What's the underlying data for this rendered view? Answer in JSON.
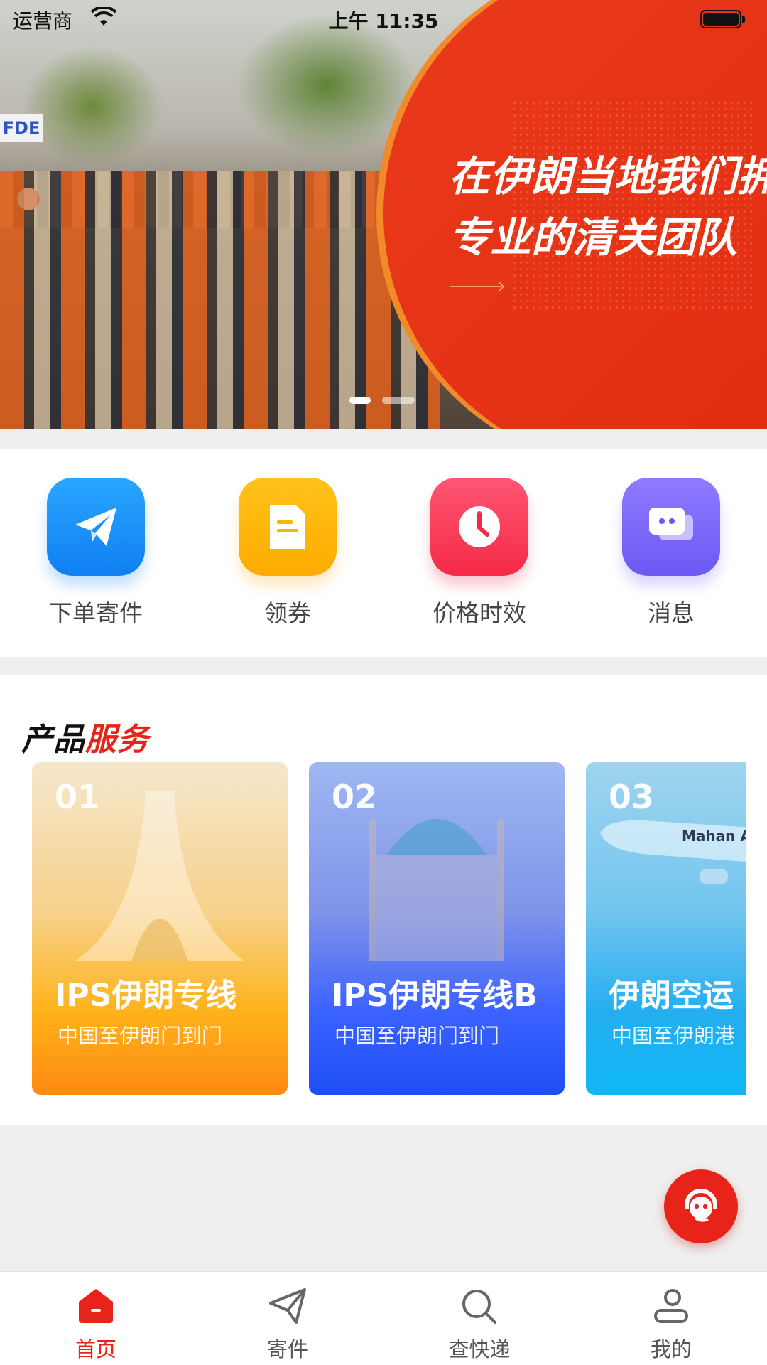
{
  "status_bar": {
    "carrier": "运营商",
    "time": "上午 11:35"
  },
  "banner": {
    "line1": "在伊朗当地我们拥有",
    "line2": "专业的清关团队",
    "sign_text": "FDE",
    "active_index": 0,
    "slide_count": 2
  },
  "quick_menu": [
    {
      "label": "下单寄件",
      "icon": "paper-plane-icon"
    },
    {
      "label": "领券",
      "icon": "coupon-document-icon"
    },
    {
      "label": "价格时效",
      "icon": "clock-icon"
    },
    {
      "label": "消息",
      "icon": "chat-bubble-icon"
    }
  ],
  "products": {
    "title_part1": "产品",
    "title_part2": "服务",
    "cards": [
      {
        "num": "01",
        "title": "IPS伊朗专线",
        "subtitle": "中国至伊朗门到门"
      },
      {
        "num": "02",
        "title": "IPS伊朗专线B",
        "subtitle": "中国至伊朗门到门"
      },
      {
        "num": "03",
        "title": "伊朗空运",
        "subtitle": "中国至伊朗港",
        "plane_text": "Mahan Ai"
      }
    ]
  },
  "tabbar": [
    {
      "label": "首页",
      "icon": "home-icon",
      "active": true
    },
    {
      "label": "寄件",
      "icon": "send-icon",
      "active": false
    },
    {
      "label": "查快递",
      "icon": "search-icon",
      "active": false
    },
    {
      "label": "我的",
      "icon": "user-icon",
      "active": false
    }
  ],
  "colors": {
    "accent": "#e8231a",
    "banner_red": "#e12a10"
  }
}
